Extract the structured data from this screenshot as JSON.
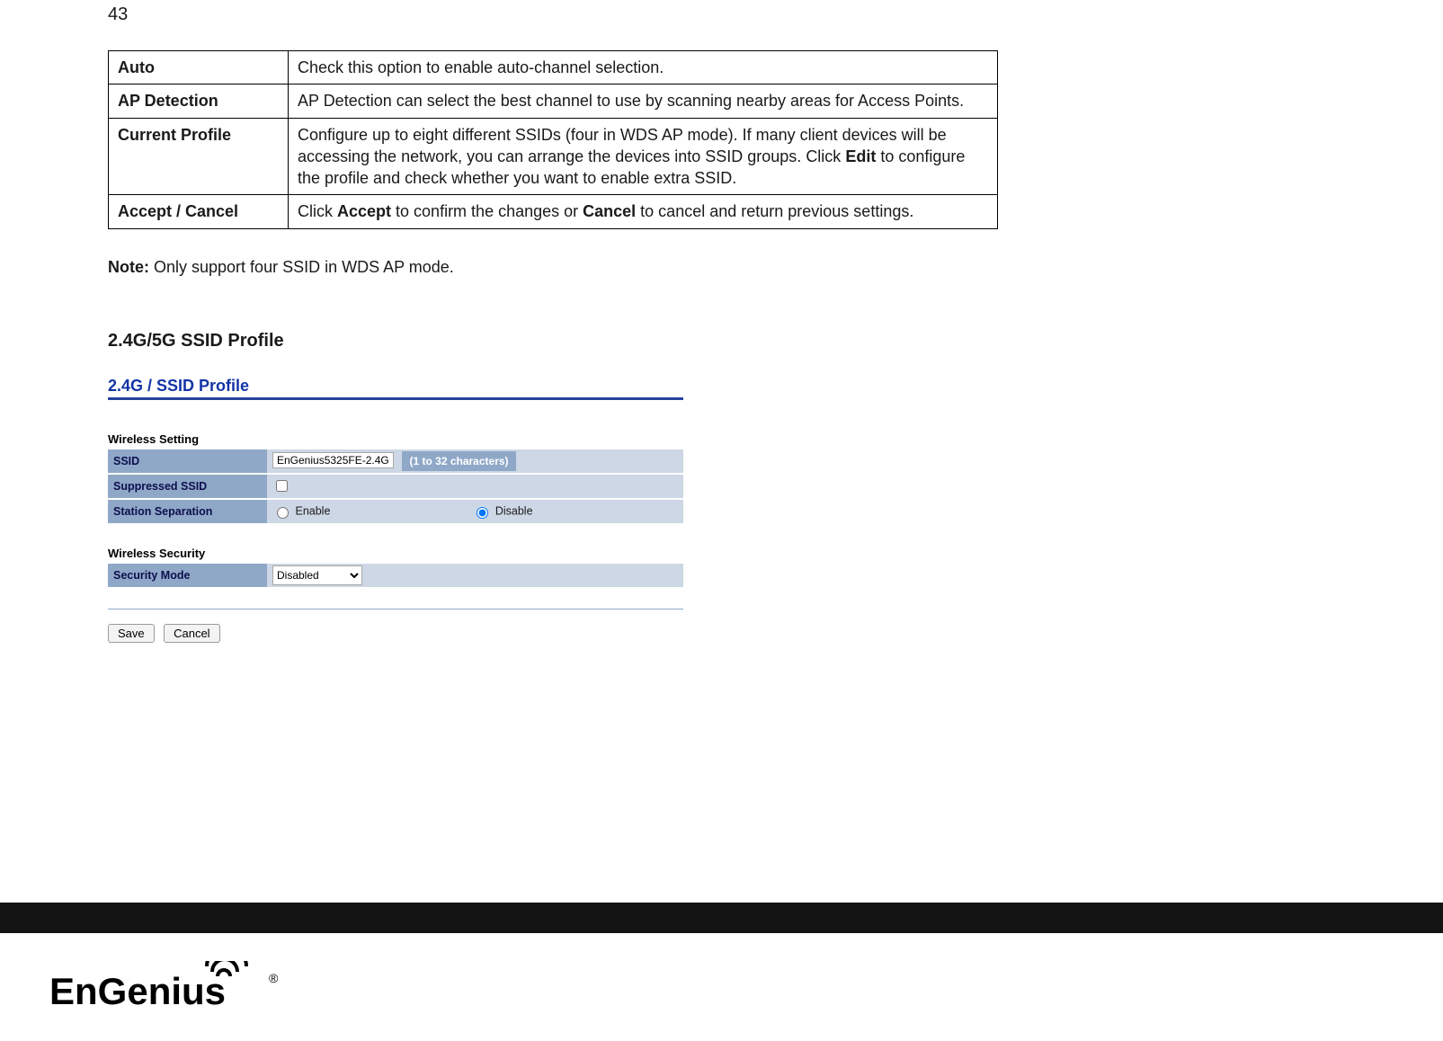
{
  "page_number": "43",
  "desc_table": {
    "rows": [
      {
        "term": "Auto",
        "desc_pre": "Check this option to enable auto-channel selection.",
        "bold1": "",
        "desc_mid": "",
        "bold2": "",
        "desc_post": ""
      },
      {
        "term": "AP Detection",
        "desc_pre": "AP Detection can select the best channel to use by scanning nearby areas for Access Points.",
        "bold1": "",
        "desc_mid": "",
        "bold2": "",
        "desc_post": ""
      },
      {
        "term": "Current Profile",
        "desc_pre": "Configure up to eight different SSIDs (four in WDS AP mode). If many client devices will be accessing the network, you can arrange the devices into SSID groups. Click ",
        "bold1": "Edit",
        "desc_mid": " to configure the profile and check whether you want to enable extra SSID.",
        "bold2": "",
        "desc_post": ""
      },
      {
        "term": "Accept / Cancel",
        "desc_pre": "Click ",
        "bold1": "Accept",
        "desc_mid": " to confirm the changes or ",
        "bold2": "Cancel",
        "desc_post": " to cancel and return previous settings."
      }
    ]
  },
  "note": {
    "label": "Note:",
    "text": " Only support four SSID in WDS AP mode."
  },
  "section_heading": "2.4G/5G SSID Profile",
  "ui": {
    "title": "2.4G / SSID Profile",
    "wireless_setting_label": "Wireless Setting",
    "wireless_security_label": "Wireless Security",
    "ssid_row": {
      "label": "SSID",
      "value": "EnGenius5325FE-2.4G",
      "hint": "(1 to 32 characters)"
    },
    "supp_row": {
      "label": "Suppressed SSID",
      "checked": false
    },
    "sep_row": {
      "label": "Station Separation",
      "enable_label": "Enable",
      "disable_label": "Disable",
      "value": "disable"
    },
    "sec_row": {
      "label": "Security Mode",
      "value": "Disabled"
    },
    "buttons": {
      "save": "Save",
      "cancel": "Cancel"
    }
  },
  "footer": {
    "brand_text": "EnGenius",
    "brand_trademark": "®"
  }
}
